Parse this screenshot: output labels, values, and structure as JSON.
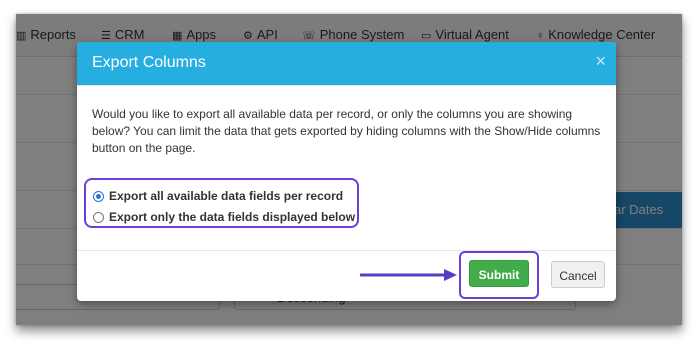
{
  "nav": {
    "items": [
      {
        "icon": "bar-chart-icon",
        "label": "Reports"
      },
      {
        "icon": "list-icon",
        "label": "CRM"
      },
      {
        "icon": "grid-icon",
        "label": "Apps"
      },
      {
        "icon": "gear-icon",
        "label": "API"
      },
      {
        "icon": "phone-icon",
        "label": "Phone System"
      },
      {
        "icon": "monitor-icon",
        "label": "Virtual Agent"
      },
      {
        "icon": "lightbulb-icon",
        "label": "Knowledge Center"
      }
    ]
  },
  "background": {
    "clear_button_label": "ar Dates",
    "sort_select_value": "Descending"
  },
  "modal": {
    "title": "Export Columns",
    "close_glyph": "×",
    "description": "Would you like to export all available data per record, or only the columns you are showing below? You can limit the data that gets exported by hiding columns with the Show/Hide columns button on the page.",
    "options": [
      {
        "label": "Export all available data fields per record",
        "checked": true
      },
      {
        "label": "Export only the data fields displayed below",
        "checked": false
      }
    ],
    "submit_label": "Submit",
    "cancel_label": "Cancel"
  },
  "colors": {
    "header": "#27aee1",
    "submit": "#43ac4a",
    "highlight": "#6b3fd4"
  }
}
